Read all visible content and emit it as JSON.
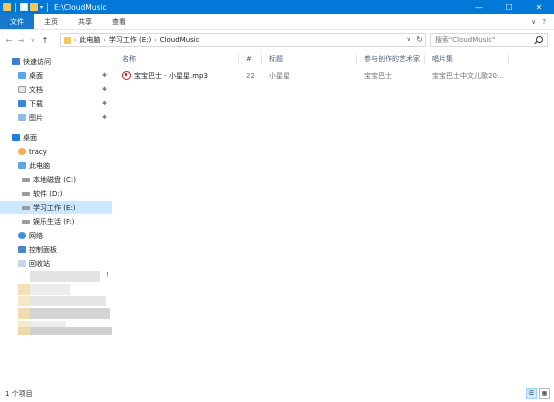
{
  "window": {
    "title": "E:\\CloudMusic",
    "quick_access_arrow": "▾",
    "controls": {
      "minimize": "—",
      "maximize": "☐",
      "close": "✕"
    }
  },
  "ribbon": {
    "tabs": [
      "文件",
      "主页",
      "共享",
      "查看"
    ],
    "collapse_glyph": "∨",
    "help_glyph": "?"
  },
  "address": {
    "back": "←",
    "forward": "→",
    "recent": "∨",
    "up": "↑",
    "breadcrumb": [
      "此电脑",
      "学习工作 (E:)",
      "CloudMusic"
    ],
    "dropdown_glyph": "∨",
    "refresh_glyph": "↻"
  },
  "search": {
    "placeholder": "搜索\"CloudMusic\""
  },
  "sidebar": {
    "items": [
      {
        "label": "快速访问",
        "icon": "star-icon",
        "pinned": false
      },
      {
        "label": "桌面",
        "icon": "desktop-icon",
        "pinned": true
      },
      {
        "label": "文档",
        "icon": "documents-icon",
        "pinned": true
      },
      {
        "label": "下载",
        "icon": "download-icon",
        "pinned": true
      },
      {
        "label": "图片",
        "icon": "pictures-icon",
        "pinned": true
      },
      {
        "label": "桌面",
        "icon": "desktop-icon",
        "pinned": false
      },
      {
        "label": "tracy",
        "icon": "user-icon",
        "pinned": false
      },
      {
        "label": "此电脑",
        "icon": "this-pc-icon",
        "pinned": false
      },
      {
        "label": "本地磁盘 (C:)",
        "icon": "drive-icon",
        "pinned": false
      },
      {
        "label": "软件 (D:)",
        "icon": "drive-icon",
        "pinned": false
      },
      {
        "label": "学习工作 (E:)",
        "icon": "drive-icon",
        "pinned": false,
        "selected": true
      },
      {
        "label": "娱乐生活 (F:)",
        "icon": "drive-icon",
        "pinned": false
      },
      {
        "label": "网络",
        "icon": "network-icon",
        "pinned": false
      },
      {
        "label": "控制面板",
        "icon": "control-panel-icon",
        "pinned": false
      },
      {
        "label": "回收站",
        "icon": "recycle-bin-icon",
        "pinned": false
      }
    ],
    "pin_glyph": "📌",
    "blur_mark": "!"
  },
  "columns": [
    "名称",
    "#",
    "标题",
    "参与创作的艺术家",
    "唱片集"
  ],
  "sort_glyph": "^",
  "files": [
    {
      "name": "宝宝巴士 - 小星星.mp3",
      "number": "22",
      "title": "小星星",
      "artist": "宝宝巴士",
      "album": "宝宝巴士中文儿歌20..."
    }
  ],
  "status": {
    "count": "1 个项目",
    "details_glyph": "☰",
    "tiles_glyph": "▦"
  }
}
